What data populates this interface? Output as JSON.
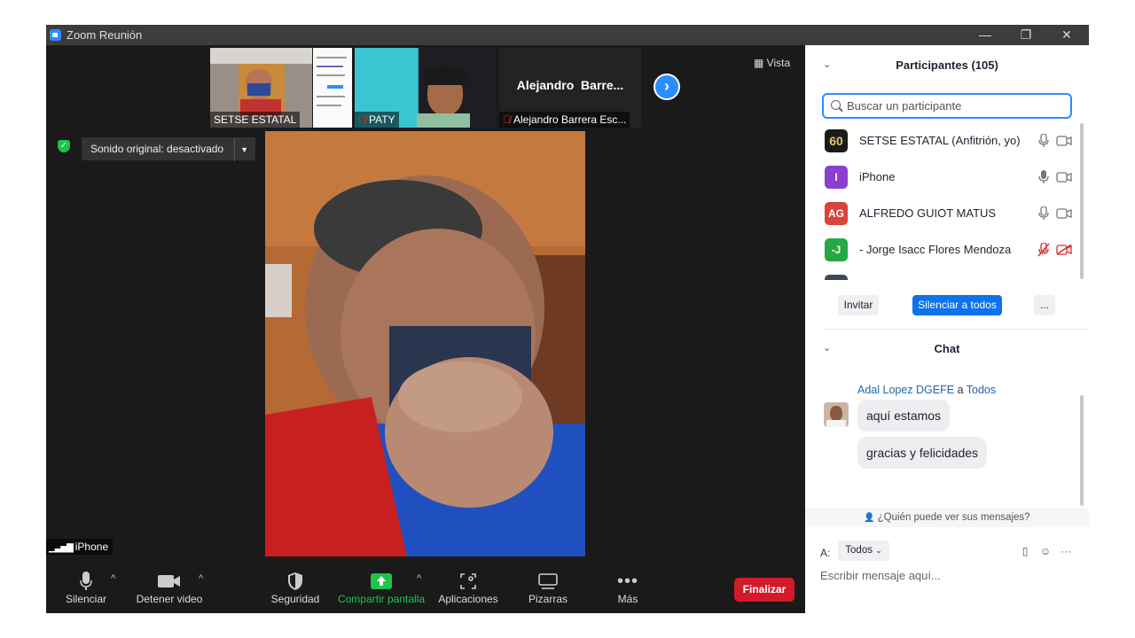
{
  "window": {
    "title": "Zoom Reunión",
    "minimize": "—",
    "restore": "❐",
    "close": "✕"
  },
  "top_strip": {
    "thumbs": [
      {
        "name": "SETSE ESTATAL",
        "muted": false
      },
      {
        "name": "PATY",
        "muted": true
      },
      {
        "name": "Alejandro Barrera Esc...",
        "muted": true,
        "big_name": "Alejandro  Barre..."
      }
    ],
    "next_icon": "chevron-right-icon"
  },
  "view_button": {
    "label": "Vista"
  },
  "original_sound": {
    "label": "Sonido original: desactivado"
  },
  "active_speaker": {
    "name": "iPhone"
  },
  "toolbar": {
    "items": [
      {
        "label": "Silenciar",
        "icon": "microphone-icon"
      },
      {
        "label": "Detener video",
        "icon": "video-camera-icon"
      },
      {
        "label": "Seguridad",
        "icon": "shield-icon"
      },
      {
        "label": "Compartir pantalla",
        "icon": "share-screen-icon"
      },
      {
        "label": "Aplicaciones",
        "icon": "apps-icon"
      },
      {
        "label": "Pizarras",
        "icon": "whiteboard-icon"
      },
      {
        "label": "Más",
        "icon": "more-icon"
      }
    ],
    "end_label": "Finalizar",
    "share_color": "#1ec34a",
    "end_color": "#d21a2a"
  },
  "participants": {
    "header": "Participantes (105)",
    "search_placeholder": "Buscar un participante",
    "list": [
      {
        "avatar": "60",
        "avatar_color": "#1b1b1b",
        "name": "SETSE ESTATAL (Anfitrión, yo)",
        "muted": false,
        "video_off": false
      },
      {
        "avatar": "I",
        "avatar_color": "#8a3fd1",
        "name": "iPhone",
        "muted": false,
        "video_off": false
      },
      {
        "avatar": "AG",
        "avatar_color": "#d8433a",
        "name": "ALFREDO GUIOT MATUS",
        "muted": false,
        "video_off": false
      },
      {
        "avatar": "-J",
        "avatar_color": "#27a844",
        "name": "- Jorge Isacc Flores Mendoza",
        "muted": true,
        "video_off": true
      }
    ],
    "invite_label": "Invitar",
    "mute_all_label": "Silenciar a todos",
    "more_label": "..."
  },
  "chat": {
    "header": "Chat",
    "sender": "Adal Lopez DGEFE",
    "to_word": "a",
    "recipient": "Todos",
    "messages": [
      "aquí estamos",
      "gracias y felicidades"
    ],
    "who_can_see": "¿Quién puede ver sus mensajes?",
    "to_label": "A:",
    "to_value": "Todos",
    "input_placeholder": "Escribir mensaje aquí..."
  }
}
